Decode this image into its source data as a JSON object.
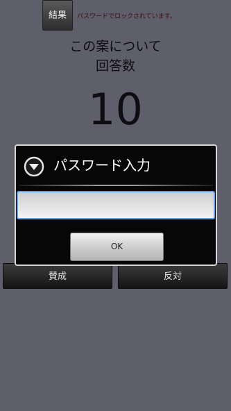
{
  "header": {
    "result_button": "結果",
    "lock_message": "パスワードでロックされています。"
  },
  "main": {
    "subject_line1": "この案について",
    "subject_line2": "回答数",
    "answer_count": "10"
  },
  "votes": {
    "agree": "賛成",
    "oppose": "反対"
  },
  "dialog": {
    "title": "パスワード入力",
    "input_value": "",
    "ok": "OK"
  }
}
